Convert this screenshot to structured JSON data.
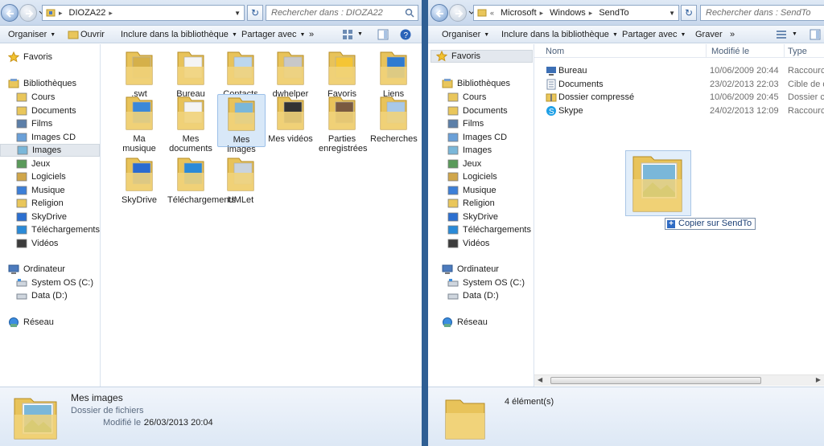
{
  "left": {
    "address": {
      "segments": [
        "DIOZA22"
      ]
    },
    "search_placeholder": "Rechercher dans : DIOZA22",
    "toolbar": {
      "organize": "Organiser",
      "open": "Ouvrir",
      "include": "Inclure dans la bibliothèque",
      "share": "Partager avec",
      "more": "»"
    },
    "nav": {
      "favorites": "Favoris",
      "libraries": "Bibliothèques",
      "library_items": [
        "Cours",
        "Documents",
        "Films",
        "Images CD",
        "Images",
        "Jeux",
        "Logiciels",
        "Musique",
        "Religion",
        "SkyDrive",
        "Téléchargements",
        "Vidéos"
      ],
      "computer": "Ordinateur",
      "drives": [
        "System OS (C:)",
        "Data (D:)"
      ],
      "network": "Réseau"
    },
    "tiles": [
      ".swt",
      "Bureau",
      "Contacts",
      "dwhelper",
      "Favoris",
      "Liens",
      "Ma musique",
      "Mes documents",
      "Mes images",
      "Mes vidéos",
      "Parties enregistrées",
      "Recherches",
      "SkyDrive",
      "Téléchargements",
      "UMLet"
    ],
    "details": {
      "name": "Mes images",
      "type": "Dossier de fichiers",
      "modified_label": "Modifié le :",
      "modified_value": "26/03/2013 20:04"
    }
  },
  "right": {
    "address": {
      "segments": [
        "Microsoft",
        "Windows",
        "SendTo"
      ],
      "overflow": "«"
    },
    "search_placeholder": "Rechercher dans : SendTo",
    "toolbar": {
      "organize": "Organiser",
      "include": "Inclure dans la bibliothèque",
      "share": "Partager avec",
      "burn": "Graver",
      "more": "»"
    },
    "columns": {
      "name": "Nom",
      "modified": "Modifié le",
      "type": "Type"
    },
    "rows": [
      {
        "name": "Bureau",
        "modified": "10/06/2009 20:44",
        "type": "Raccourci B"
      },
      {
        "name": "Documents",
        "modified": "23/02/2013 22:03",
        "type": "Cible de dé"
      },
      {
        "name": "Dossier compressé",
        "modified": "10/06/2009 20:45",
        "type": "Dossier co"
      },
      {
        "name": "Skype",
        "modified": "24/02/2013 12:09",
        "type": "Raccourci"
      }
    ],
    "drag_tooltip": "Copier sur SendTo",
    "status_count": "4 élément(s)"
  }
}
